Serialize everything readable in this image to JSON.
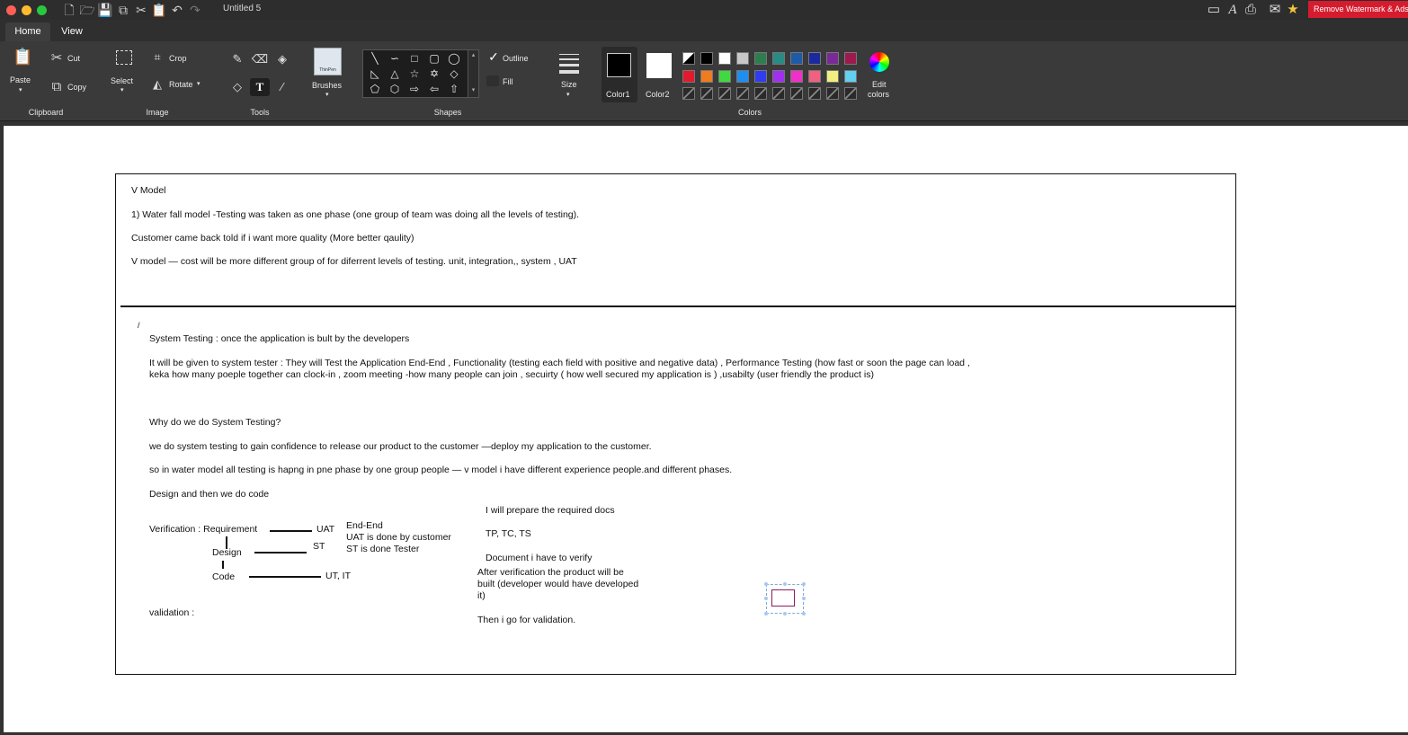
{
  "window": {
    "title": "Untitled 5"
  },
  "topbar": {
    "remove_watermark": "Remove Watermark & Ads"
  },
  "tabs": [
    "Home",
    "View"
  ],
  "ribbon": {
    "clipboard": {
      "paste": "Paste",
      "cut": "Cut",
      "copy": "Copy",
      "group": "Clipboard"
    },
    "image": {
      "select": "Select",
      "crop": "Crop",
      "rotate": "Rotate",
      "group": "Image"
    },
    "tools": {
      "group": "Tools"
    },
    "brushes": {
      "label": "Brushes",
      "thumb": "ThinPen"
    },
    "shapes": {
      "outline": "Outline",
      "fill": "Fill",
      "group": "Shapes"
    },
    "size": {
      "label": "Size"
    },
    "colors": {
      "color1": "Color1",
      "color2": "Color2",
      "edit": [
        "Edit",
        "colors"
      ],
      "group": "Colors",
      "color1_value": "#000000",
      "color2_value": "#ffffff",
      "palette_row1": [
        "#000000",
        "#ffffff",
        "#c8c8c8",
        "#2e7d4f",
        "#2a8a84",
        "#1e5aa8",
        "#1a2a9e",
        "#7a2a96",
        "#9e1a4e"
      ],
      "palette_row2": [
        "#e3192d",
        "#f07c1e",
        "#41d941",
        "#1e8ef0",
        "#2f3cf0",
        "#a030f0",
        "#f030c8",
        "#f06080",
        "#f0f080",
        "#62d0f0"
      ]
    }
  },
  "document": {
    "lines": {
      "l1": "V Model",
      "l2": "1) Water fall model -Testing was taken as one phase (one group of team was doing all the levels of testing).",
      "l3": "Customer came back told if i want more quality (More better qaulity)",
      "l4": "V model — cost will be more different group of for diferrent levels of testing. unit, integration,, system , UAT",
      "l5": "System Testing : once the application is bult by the developers",
      "l6": "It will be given to system tester : They will Test the Application End-End , Functionality (testing each field with positive and negative data) , Performance Testing (how fast or soon the page can load ,",
      "l7": "keka how many poeple together can clock-in , zoom meeting -how many people can join , secuirty ( how well secured my application is ) ,usabilty (user friendly the product is)",
      "l8": "Why do we do System Testing?",
      "l9": "we do system testing to gain confidence to release our product to the customer —deploy my application to the customer.",
      "l10": "so in water model all testing is hapng in pne phase by one group people — v model i have different experience people.and different phases.",
      "l11": "Design and then we do code",
      "l12": "I will prepare the required docs",
      "l13": "Verification : Requirement",
      "l14": "UAT",
      "l15": "End-End",
      "l16": "UAT is done by customer",
      "l17": "ST is done Tester",
      "l18": "TP, TC, TS",
      "l19": "ST",
      "l20": "Design",
      "l21": "Code",
      "l22": "UT, IT",
      "l23": "Document i have to verify",
      "l24": "After verification the product will be",
      "l25": "built (developer would have developed",
      "l26": "it)",
      "l27": "validation :",
      "l28": "Then i go for validation."
    }
  }
}
